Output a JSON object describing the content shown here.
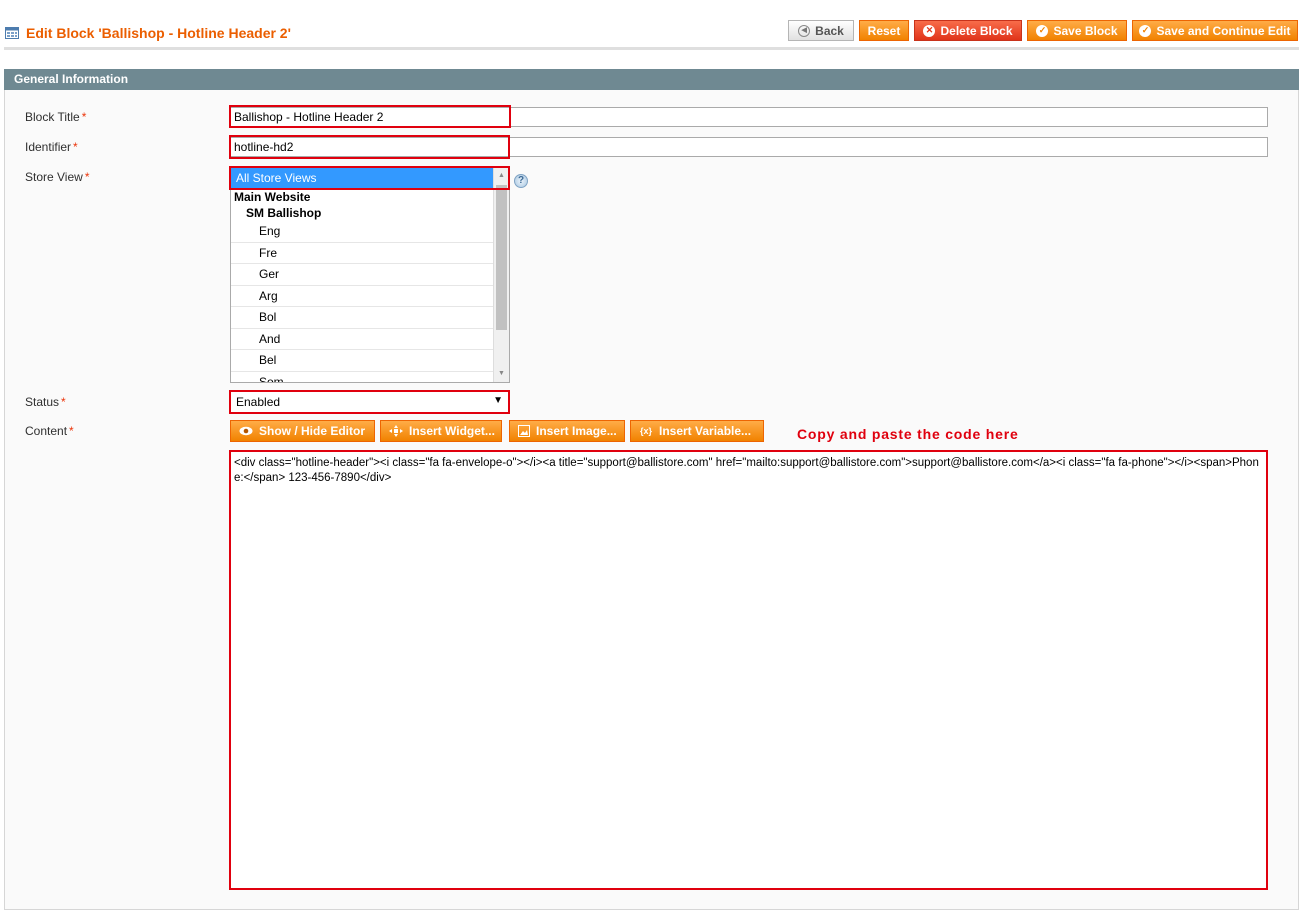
{
  "header": {
    "title": "Edit Block 'Ballishop - Hotline Header 2'",
    "buttons": {
      "back": "Back",
      "reset": "Reset",
      "delete": "Delete Block",
      "save": "Save Block",
      "save_continue": "Save and Continue Edit"
    }
  },
  "section": {
    "title": "General Information"
  },
  "form": {
    "block_title": {
      "label": "Block Title",
      "required": "*",
      "value": "Ballishop - Hotline Header 2"
    },
    "identifier": {
      "label": "Identifier",
      "required": "*",
      "value": "hotline-hd2"
    },
    "store_view": {
      "label": "Store View",
      "required": "*",
      "selected": "All Store Views",
      "group": "Main Website",
      "subgroup": "SM Ballishop",
      "options": [
        "Eng",
        "Fre",
        "Ger",
        "Arg",
        "Bol",
        "And",
        "Bel",
        "Som"
      ],
      "help": "?"
    },
    "status": {
      "label": "Status",
      "required": "*",
      "value": "Enabled"
    },
    "content": {
      "label": "Content",
      "required": "*",
      "buttons": {
        "toggle_editor": "Show / Hide Editor",
        "insert_widget": "Insert Widget...",
        "insert_image": "Insert Image...",
        "insert_variable": "Insert Variable..."
      },
      "note": "Copy and paste the code here",
      "value": "<div class=\"hotline-header\"><i class=\"fa fa-envelope-o\"></i><a title=\"support@ballistore.com\" href=\"mailto:support@ballistore.com\">support@ballistore.com</a><i class=\"fa fa-phone\"></i><span>Phone:</span> 123-456-7890</div>"
    }
  },
  "colors": {
    "accent": "#eb5e00",
    "button": "#f18200",
    "section_header": "#6f8992",
    "highlight": "#e0000e"
  }
}
